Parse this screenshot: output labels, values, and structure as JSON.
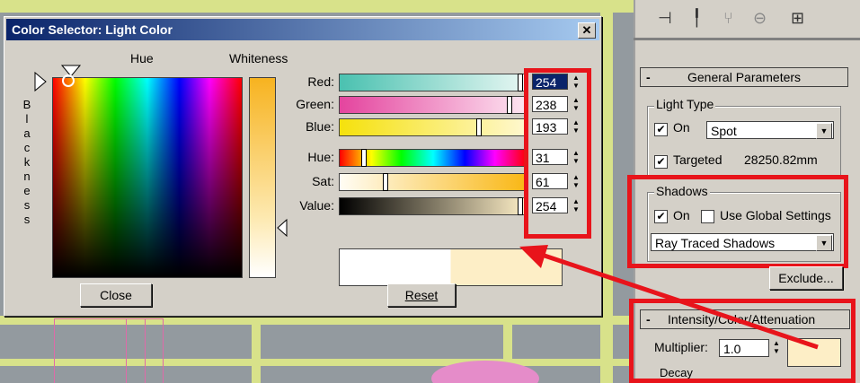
{
  "dialog": {
    "title": "Color Selector: Light Color",
    "close_glyph": "✕",
    "hue_label": "Hue",
    "whiteness_label": "Whiteness",
    "blackness_letters": [
      "B",
      "l",
      "a",
      "c",
      "k",
      "n",
      "e",
      "s",
      "s"
    ],
    "channels": [
      {
        "label": "Red:",
        "value": "254",
        "level": 0.99
      },
      {
        "label": "Green:",
        "value": "238",
        "level": 0.93
      },
      {
        "label": "Blue:",
        "value": "193",
        "level": 0.76
      },
      {
        "label": "Hue:",
        "value": "31",
        "level": 0.12
      },
      {
        "label": "Sat:",
        "value": "61",
        "level": 0.24
      },
      {
        "label": "Value:",
        "value": "254",
        "level": 0.99
      }
    ],
    "close_button": "Close",
    "reset_button": "Reset",
    "spinner_up": "▲",
    "spinner_down": "▼",
    "preview_colors": {
      "old": "#ffffff",
      "new": "#fdeec6"
    }
  },
  "panel": {
    "general_parameters": "General Parameters",
    "light_type_label": "Light Type",
    "on_label": "On",
    "on_checked": true,
    "light_type_value": "Spot",
    "targeted_label": "Targeted",
    "targeted_checked": true,
    "targeted_distance": "28250.82mm",
    "shadows_label": "Shadows",
    "shadows_on_label": "On",
    "shadows_on_checked": true,
    "use_global_label": "Use Global Settings",
    "use_global_checked": false,
    "shadow_type": "Ray Traced Shadows",
    "exclude_button": "Exclude...",
    "intensity_rollout": "Intensity/Color/Attenuation",
    "multiplier_label": "Multiplier:",
    "multiplier_value": "1.0",
    "decay_label": "Decay",
    "rollout_minus": "-",
    "checkmark": "✔",
    "dropdown_arrow": "▼",
    "light_color_swatch": "#fdeec6"
  },
  "colors": {
    "highlight_red": "#e8141b",
    "selection_blue": "#0a246a"
  }
}
